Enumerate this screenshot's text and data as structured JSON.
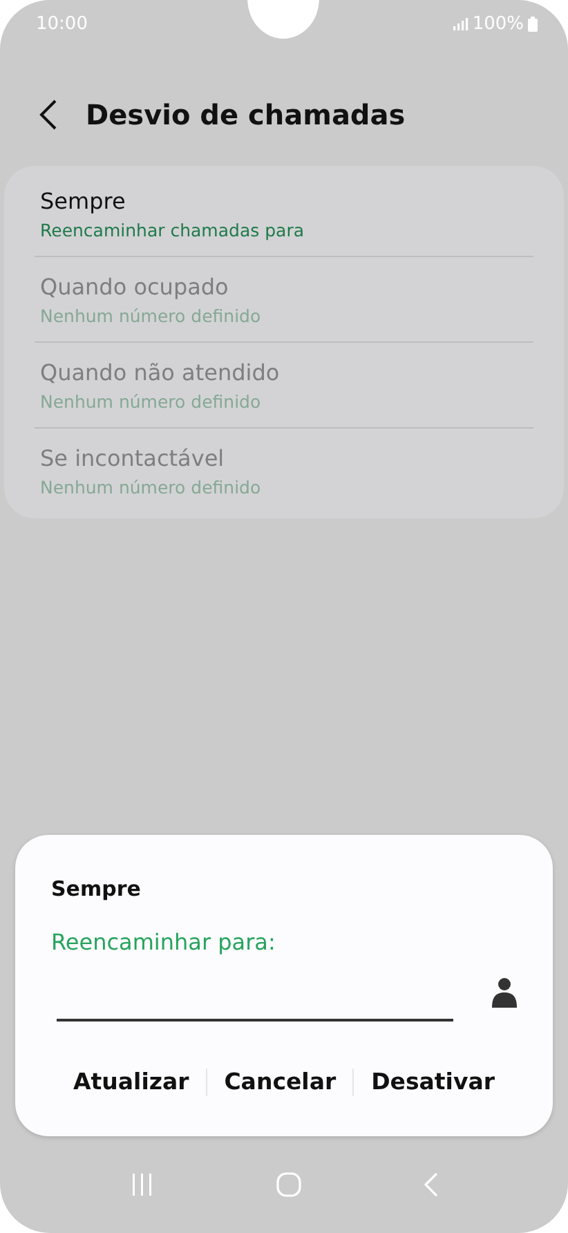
{
  "status_bar": {
    "time": "10:00",
    "battery": "100%"
  },
  "header": {
    "title": "Desvio de chamadas"
  },
  "items": [
    {
      "title": "Sempre",
      "subtitle": "Reencaminhar chamadas para",
      "disabled": false
    },
    {
      "title": "Quando ocupado",
      "subtitle": "Nenhum número definido",
      "disabled": true
    },
    {
      "title": "Quando não atendido",
      "subtitle": "Nenhum número definido",
      "disabled": true
    },
    {
      "title": "Se incontactável",
      "subtitle": "Nenhum número definido",
      "disabled": true
    }
  ],
  "dialog": {
    "title": "Sempre",
    "label": "Reencaminhar para:",
    "buttons": [
      "Atualizar",
      "Cancelar",
      "Desativar"
    ]
  }
}
